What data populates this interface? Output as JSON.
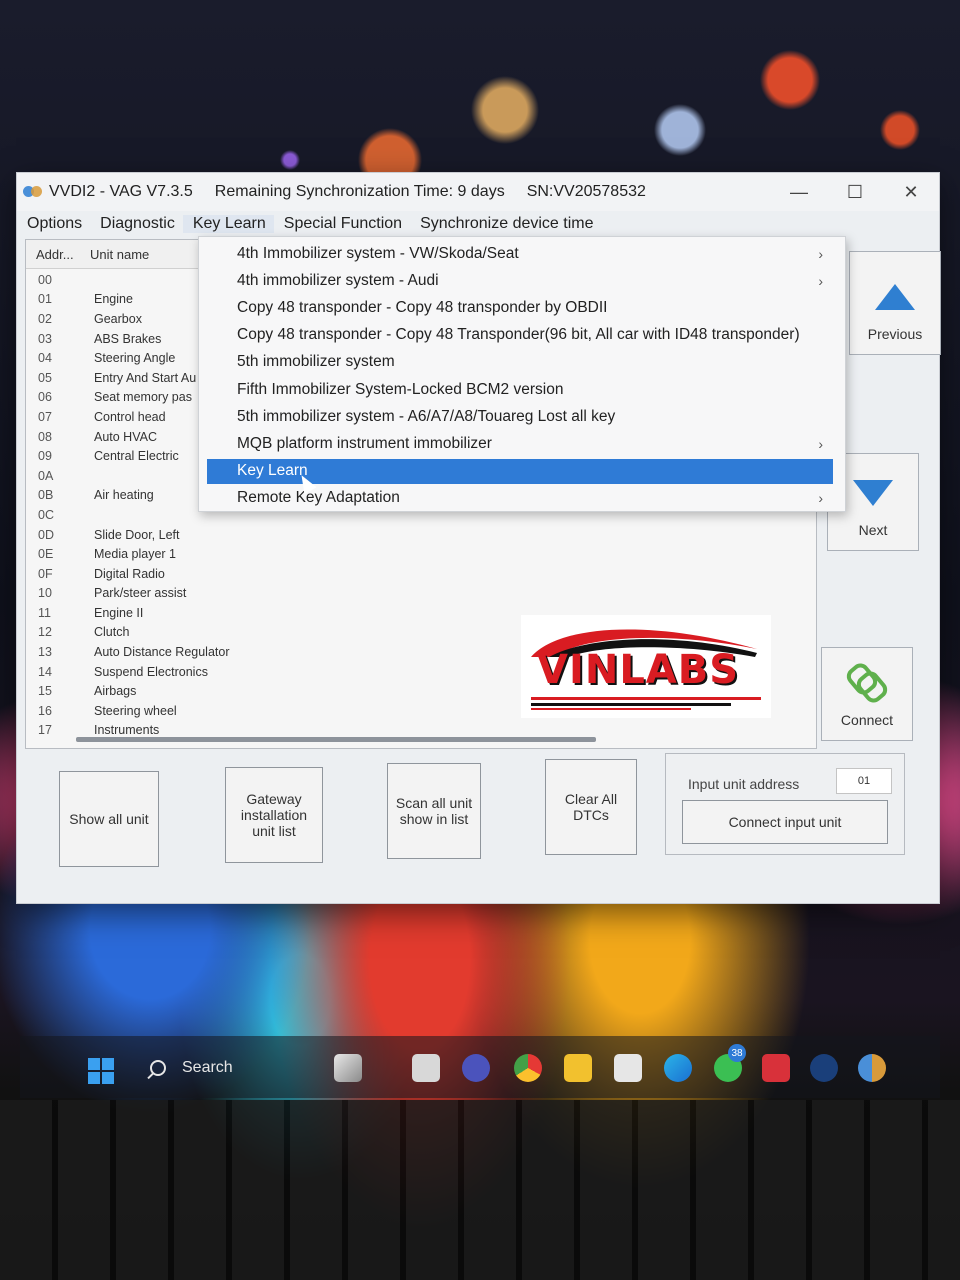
{
  "window": {
    "app_title": "VVDI2 - VAG V7.3.5",
    "sync_time": "Remaining Synchronization Time: 9 days",
    "serial": "SN:VV20578532",
    "minimize": "—",
    "maximize": "☐",
    "close": "✕"
  },
  "menubar": {
    "items": [
      "Options",
      "Diagnostic",
      "Key Learn",
      "Special Function",
      "Synchronize device time"
    ],
    "open_item": "Key Learn"
  },
  "unit_list": {
    "col_addr": "Addr...",
    "col_name": "Unit name",
    "rows": [
      {
        "addr": "00",
        "name": ""
      },
      {
        "addr": "01",
        "name": "Engine"
      },
      {
        "addr": "02",
        "name": "Gearbox"
      },
      {
        "addr": "03",
        "name": "ABS Brakes"
      },
      {
        "addr": "04",
        "name": "Steering Angle"
      },
      {
        "addr": "05",
        "name": "Entry And Start Au"
      },
      {
        "addr": "06",
        "name": "Seat memory pas"
      },
      {
        "addr": "07",
        "name": "Control head"
      },
      {
        "addr": "08",
        "name": "Auto HVAC"
      },
      {
        "addr": "09",
        "name": "Central Electric"
      },
      {
        "addr": "0A",
        "name": ""
      },
      {
        "addr": "0B",
        "name": "Air heating"
      },
      {
        "addr": "0C",
        "name": ""
      },
      {
        "addr": "0D",
        "name": "Slide Door, Left"
      },
      {
        "addr": "0E",
        "name": "Media player 1"
      },
      {
        "addr": "0F",
        "name": "Digital Radio"
      },
      {
        "addr": "10",
        "name": "Park/steer assist"
      },
      {
        "addr": "11",
        "name": "Engine II"
      },
      {
        "addr": "12",
        "name": "Clutch"
      },
      {
        "addr": "13",
        "name": "Auto Distance Regulator"
      },
      {
        "addr": "14",
        "name": "Suspend Electronics"
      },
      {
        "addr": "15",
        "name": "Airbags"
      },
      {
        "addr": "16",
        "name": "Steering wheel"
      },
      {
        "addr": "17",
        "name": "Instruments"
      }
    ]
  },
  "side_buttons": {
    "previous": "Previous",
    "next": "Next",
    "connect": "Connect"
  },
  "bottom_buttons": {
    "show_all_unit": "Show all unit",
    "gateway_list": "Gateway installation unit list",
    "scan_all_unit": "Scan all unit show in list",
    "clear_all_dtcs": "Clear All DTCs",
    "input_unit_address_label": "Input unit address",
    "input_unit_address_value": "01",
    "connect_input_unit": "Connect input unit"
  },
  "key_learn_menu": {
    "items": [
      {
        "label": "4th Immobilizer system - VW/Skoda/Seat",
        "submenu": true
      },
      {
        "label": "4th immobilizer system - Audi",
        "submenu": true
      },
      {
        "label": "Copy 48 transponder - Copy 48 transponder by OBDII",
        "submenu": false
      },
      {
        "label": "Copy 48 transponder - Copy 48 Transponder(96 bit, All car with ID48 transponder)",
        "submenu": false
      },
      {
        "label": "5th immobilizer system",
        "submenu": false
      },
      {
        "label": "Fifth Immobilizer System-Locked BCM2 version",
        "submenu": false
      },
      {
        "label": "5th immobilizer system - A6/A7/A8/Touareg Lost all key",
        "submenu": false
      },
      {
        "label": "MQB platform instrument immobilizer",
        "submenu": true
      },
      {
        "label": "Key Learn",
        "submenu": false
      },
      {
        "label": "Remote Key Adaptation",
        "submenu": true
      }
    ],
    "selected": "Key Learn",
    "submenu_arrow": "›"
  },
  "watermark": {
    "text": "VINLABS"
  },
  "taskbar": {
    "search_label": "Search",
    "whatsapp_badge": "38"
  },
  "colors": {
    "accent": "#2f7bd6",
    "arrow_blue": "#2f7fd1",
    "connect_green": "#5fb04c",
    "logo_red": "#d91c22"
  }
}
